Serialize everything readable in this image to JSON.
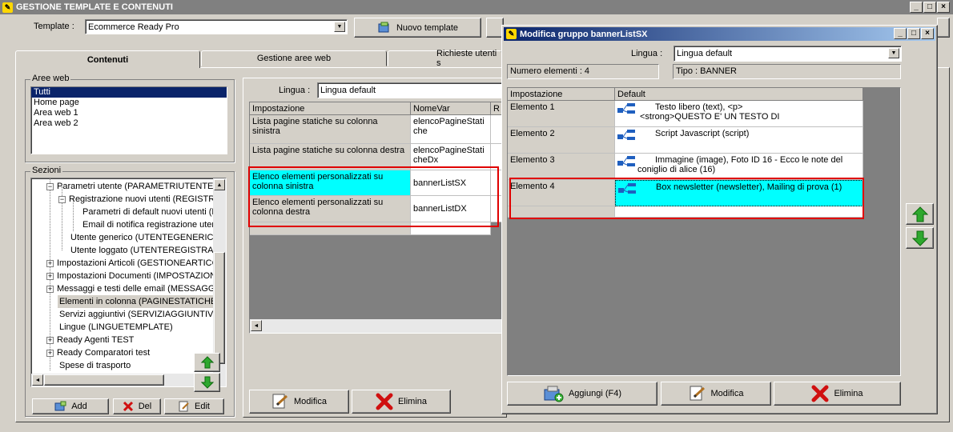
{
  "window": {
    "title": "GESTIONE TEMPLATE E CONTENUTI"
  },
  "top": {
    "template_label": "Template :",
    "template_value": "Ecommerce Ready Pro",
    "new_template_label": "Nuovo template"
  },
  "tabs": [
    {
      "label": "Contenuti"
    },
    {
      "label": "Gestione aree web"
    },
    {
      "label": "Richieste utenti s"
    }
  ],
  "areeweb": {
    "label": "Aree web",
    "items": [
      "Tutti",
      "Home page",
      "Area web 1",
      "Area web 2"
    ]
  },
  "sezioni": {
    "label": "Sezioni",
    "items": [
      {
        "text": "Parametri utente (PARAMETRIUTENTE"
      },
      {
        "text": "Registrazione nuovi utenti (REGISTR"
      },
      {
        "text": "Parametri di default nuovi utenti (P"
      },
      {
        "text": "Email di notifica registrazione utent"
      },
      {
        "text": "Utente generico (UTENTEGENERICI"
      },
      {
        "text": "Utente loggato (UTENTEREGISTRA"
      },
      {
        "text": "Impostazioni Articoli (GESTIONEARTICC"
      },
      {
        "text": "Impostazioni Documenti (IMPOSTAZION"
      },
      {
        "text": "Messaggi e testi delle email (MESSAGGI"
      },
      {
        "text": "Elementi in colonna (PAGINESTATICHE"
      },
      {
        "text": "Servizi aggiuntivi (SERVIZIAGGIUNTIVI"
      },
      {
        "text": "Lingue (LINGUETEMPLATE)"
      },
      {
        "text": "Ready Agenti TEST"
      },
      {
        "text": "Ready Comparatori test"
      },
      {
        "text": "Spese di trasporto"
      }
    ],
    "add_label": "Add",
    "del_label": "Del",
    "edit_label": "Edit"
  },
  "content": {
    "lingua_label": "Lingua :",
    "lingua_value": "Lingua default",
    "columns": [
      "Impostazione",
      "NomeVar",
      "R"
    ],
    "rows": [
      {
        "impostazione": "Lista pagine statiche su colonna sinistra",
        "nomevar": "elencoPagineStatiche"
      },
      {
        "impostazione": "Lista pagine statiche su colonna destra",
        "nomevar": "elencoPagineStaticheDx"
      },
      {
        "impostazione": "Elenco elementi personalizzati su colonna sinistra",
        "nomevar": "bannerListSX"
      },
      {
        "impostazione": "Elenco elementi personalizzati su colonna destra",
        "nomevar": "bannerListDX"
      }
    ],
    "modifica_label": "Modifica",
    "elimina_label": "Elimina"
  },
  "dialog": {
    "title": "Modifica gruppo bannerListSX",
    "lingua_label": "Lingua :",
    "lingua_value": "Lingua default",
    "numero_elementi": "Numero elementi : 4",
    "tipo": "Tipo : BANNER",
    "columns": [
      "Impostazione",
      "Default"
    ],
    "rows": [
      {
        "impostazione": "Elemento 1",
        "line1": "Testo libero (text), <p>",
        "line2": "<strong>QUESTO E' UN TESTO DI"
      },
      {
        "impostazione": "Elemento 2",
        "line1": "Script Javascript (script)",
        "line2": ""
      },
      {
        "impostazione": "Elemento 3",
        "line1": "Immagine (image), Foto ID 16 - Ecco le note del",
        "line2": "coniglio di alice (16)"
      },
      {
        "impostazione": "Elemento 4",
        "line1": "Box newsletter (newsletter), Mailing di prova (1)",
        "line2": ""
      }
    ],
    "aggiungi_label": "Aggiungi (F4)",
    "modifica_label": "Modifica",
    "elimina_label": "Elimina"
  },
  "colors": {
    "selection": "#0a246a",
    "highlight": "#00ffff",
    "redbox": "#e00000",
    "arrow_green": "#2ea82e"
  }
}
